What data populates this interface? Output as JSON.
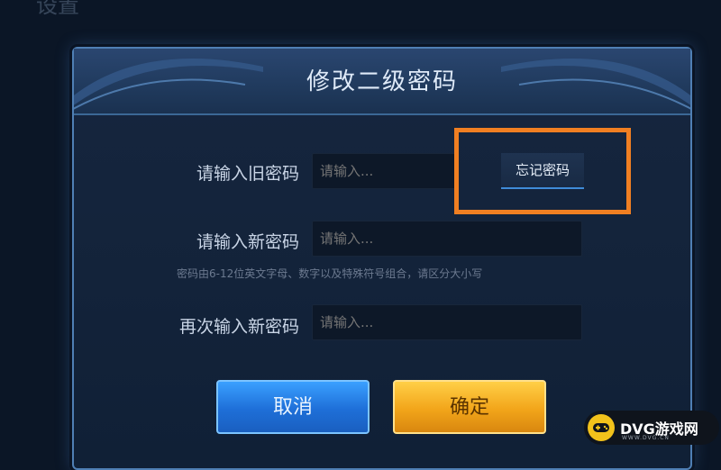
{
  "background": {
    "title": "设置"
  },
  "dialog": {
    "title": "修改二级密码",
    "old_password": {
      "label": "请输入旧密码",
      "placeholder": "请输入..."
    },
    "forgot_button": "忘记密码",
    "new_password": {
      "label": "请输入新密码",
      "placeholder": "请输入..."
    },
    "hint": "密码由6-12位英文字母、数字以及特殊符号组合，请区分大小写",
    "confirm_password": {
      "label": "再次输入新密码",
      "placeholder": "请输入..."
    },
    "cancel_button": "取消",
    "confirm_button": "确定"
  },
  "watermark": {
    "brand": "DVG游戏网",
    "url": "WWW.DVG.CN"
  },
  "colors": {
    "highlight": "#f07f22",
    "cancel": "#1e6fd8",
    "confirm": "#f2a51a",
    "dialog_bg": "#13233a"
  }
}
